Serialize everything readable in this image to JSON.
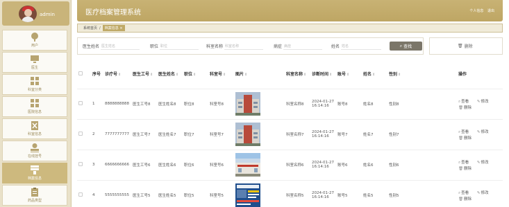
{
  "sidebar": {
    "admin_name": "admin",
    "items": [
      {
        "label": "用户",
        "icon": "user-icon"
      },
      {
        "label": "医生",
        "icon": "monitor-icon"
      },
      {
        "label": "科室分类",
        "icon": "grid-icon"
      },
      {
        "label": "医院信息",
        "icon": "grid-icon"
      },
      {
        "label": "科室信息",
        "icon": "x-box-icon"
      },
      {
        "label": "在线挂号",
        "icon": "stamp-icon"
      },
      {
        "label": "档案信息",
        "icon": "form-icon"
      },
      {
        "label": "药品类型",
        "icon": "clipboard-icon"
      }
    ]
  },
  "header": {
    "title": "医疗档案管理系统",
    "link_profile": "个人信息",
    "link_logout": "退出"
  },
  "breadcrumb": {
    "home": "系统首页",
    "current": "档案信息"
  },
  "search": {
    "doctor_name_label": "医生姓名",
    "doctor_name_placeholder": "医生姓名",
    "position_label": "职位",
    "position_placeholder": "职位",
    "dept_label": "科室名称",
    "dept_placeholder": "科室名称",
    "disease_label": "病症",
    "disease_placeholder": "病症",
    "name_label": "姓名",
    "name_placeholder": "姓名",
    "search_button": "查找",
    "delete_button": "删除"
  },
  "table": {
    "headers": [
      "序号",
      "诊疗号",
      "医生工号",
      "医生姓名",
      "职位",
      "科室号",
      "图片",
      "科室名称",
      "诊断时间",
      "账号",
      "姓名",
      "性别",
      "操作"
    ],
    "ops": {
      "view": "查看",
      "edit": "修改",
      "delete": "删除"
    },
    "rows": [
      {
        "no": "1",
        "id": "8888888888",
        "doc_no": "医生工号8",
        "doc_name": "医生姓名8",
        "position": "职位8",
        "dept_no": "科室号8",
        "dept_name": "科室名称8",
        "time": "2024-01-27 16:14:16",
        "account": "账号8",
        "name": "姓名8",
        "gender": "性别8"
      },
      {
        "no": "2",
        "id": "7777777777",
        "doc_no": "医生工号7",
        "doc_name": "医生姓名7",
        "position": "职位7",
        "dept_no": "科室号7",
        "dept_name": "科室名称7",
        "time": "2024-01-27 16:14:16",
        "account": "账号7",
        "name": "姓名7",
        "gender": "性别7"
      },
      {
        "no": "3",
        "id": "6666666666",
        "doc_no": "医生工号6",
        "doc_name": "医生姓名6",
        "position": "职位6",
        "dept_no": "科室号6",
        "dept_name": "科室名称6",
        "time": "2024-01-27 16:14:16",
        "account": "账号6",
        "name": "姓名6",
        "gender": "性别6"
      },
      {
        "no": "4",
        "id": "5555555555",
        "doc_no": "医生工号5",
        "doc_name": "医生姓名5",
        "position": "职位5",
        "dept_no": "科室号5",
        "dept_name": "科室名称5",
        "time": "2024-01-27 16:14:16",
        "account": "账号5",
        "name": "姓名5",
        "gender": "性别5"
      }
    ]
  },
  "colors": {
    "accent": "#c8b274",
    "sidebar_bg": "#e9e1c9",
    "button_dark": "#7b7669"
  }
}
